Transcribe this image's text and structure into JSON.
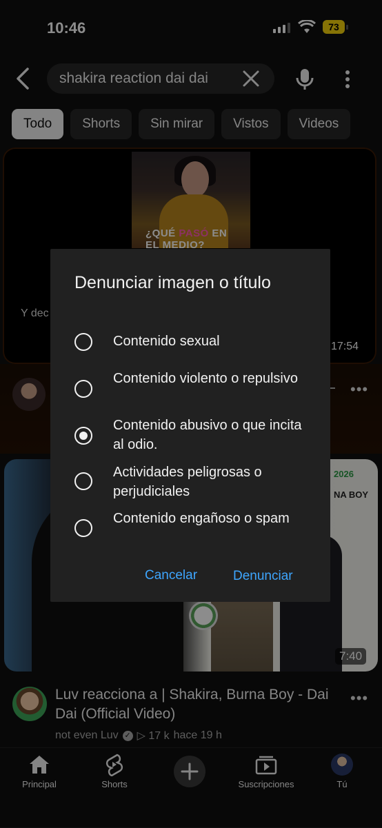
{
  "status_bar": {
    "time": "10:46",
    "battery": "73"
  },
  "search": {
    "query": "shakira reaction dai dai"
  },
  "chips": [
    {
      "label": "Todo",
      "active": true
    },
    {
      "label": "Shorts",
      "active": false
    },
    {
      "label": "Sin mirar",
      "active": false
    },
    {
      "label": "Vistos",
      "active": false
    },
    {
      "label": "Videos",
      "active": false
    }
  ],
  "feed": {
    "card1": {
      "thumb_text_a": "¿QUÉ ",
      "thumb_text_b": "PASÓ",
      "thumb_text_c": " EN",
      "thumb_text_d": "EL MEDIO?",
      "partial_title": "Y dec",
      "duration": "17:54"
    },
    "card2": {
      "thumb_year": "2026",
      "thumb_name": "NA BOY",
      "duration": "7:40",
      "title": "Luv reacciona a | Shakira, Burna Boy - Dai Dai (Official Video)",
      "channel": "not even Luv",
      "views": "▷ 17 k",
      "age": "hace 19 h"
    }
  },
  "dialog": {
    "title": "Denunciar imagen o título",
    "options": [
      {
        "label": "Contenido sexual",
        "selected": false
      },
      {
        "label": "Contenido violento o repulsivo",
        "selected": false
      },
      {
        "label": "Contenido abusivo o que incita al odio.",
        "selected": true
      },
      {
        "label": "Actividades peligrosas o perjudiciales",
        "selected": false
      },
      {
        "label": "Contenido engañoso o spam",
        "selected": false
      }
    ],
    "cancel_label": "Cancelar",
    "report_label": "Denunciar"
  },
  "bottom_nav": [
    {
      "label": "Principal",
      "icon": "home-icon"
    },
    {
      "label": "Shorts",
      "icon": "shorts-icon"
    },
    {
      "label": "",
      "icon": "plus-icon"
    },
    {
      "label": "Suscripciones",
      "icon": "subscriptions-icon"
    },
    {
      "label": "Tú",
      "icon": "avatar"
    }
  ],
  "colors": {
    "accent_link": "#3ea6ff",
    "battery": "#f5d20b",
    "dialog_bg": "#212121"
  }
}
